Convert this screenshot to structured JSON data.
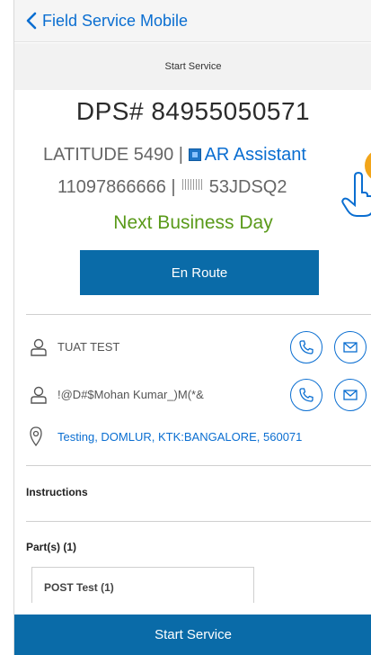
{
  "nav": {
    "back_label": "Field Service Mobile"
  },
  "subheader": {
    "title": "Start Service"
  },
  "order": {
    "dps": "DPS# 84955050571",
    "model": "LATITUDE 5490 |",
    "ar_assistant": "AR Assistant",
    "phone_prefix": "11097866666 |",
    "service_tag": "53JDSQ2",
    "service_level": "Next Business Day"
  },
  "actions": {
    "en_route": "En Route",
    "start_service": "Start Service"
  },
  "contacts": [
    {
      "name": "TUAT TEST"
    },
    {
      "name": "!@D#$Mohan Kumar_)M(*&"
    }
  ],
  "address": "Testing, DOMLUR, KTK:BANGALORE, 560071",
  "instructions_label": "Instructions",
  "parts_label": "Part(s) (1)",
  "parts": [
    {
      "label": "POST Test  (1)"
    }
  ],
  "colors": {
    "accent": "#0a6ed1",
    "button": "#0a6ba8",
    "service_level": "#5a9a1a",
    "hint": "#f2a51a"
  },
  "icons": [
    "chevron-left-icon",
    "ar-icon",
    "barcode-icon",
    "person-icon",
    "phone-icon",
    "mail-icon",
    "map-pin-icon",
    "pointing-hand-icon"
  ]
}
